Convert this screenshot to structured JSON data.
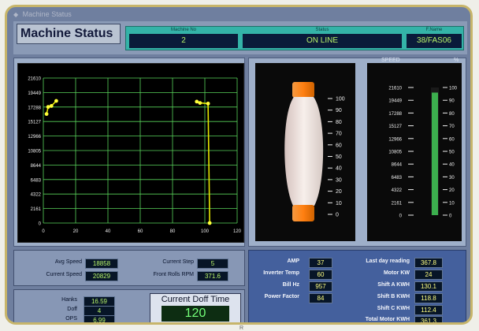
{
  "window": {
    "title": "Machine Status"
  },
  "header": {
    "title": "Machine Status",
    "machine_no_label": "Machine No",
    "machine_no": "2",
    "status_label": "Status",
    "status": "ON LINE",
    "fname_label": "F.Name",
    "fname": "38/FAS06"
  },
  "speed_chart": {
    "y_ticks": [
      "21610",
      "19449",
      "17288",
      "15127",
      "12966",
      "10805",
      "8644",
      "6483",
      "4322",
      "2161",
      "0"
    ],
    "x_ticks": [
      "0",
      "20",
      "40",
      "60",
      "80",
      "100",
      "120"
    ]
  },
  "chart_data": {
    "type": "scatter",
    "xlim": [
      0,
      120
    ],
    "ylim": [
      0,
      21610
    ],
    "series": [
      {
        "values": [
          [
            2,
            16250
          ],
          [
            3,
            17300
          ],
          [
            5,
            17450
          ],
          [
            8,
            18200
          ],
          [
            95,
            18100
          ],
          [
            97,
            17900
          ],
          [
            102,
            17800
          ],
          [
            103,
            0
          ]
        ]
      }
    ]
  },
  "bobbin_scale": [
    "100",
    "90",
    "80",
    "70",
    "60",
    "50",
    "40",
    "30",
    "20",
    "10",
    "0"
  ],
  "gauge": {
    "title": "SPEED",
    "unit": "%",
    "left_ticks": [
      "21610",
      "19449",
      "17288",
      "15127",
      "12966",
      "10805",
      "8644",
      "6483",
      "4322",
      "2161",
      "0"
    ],
    "right_ticks": [
      "100",
      "90",
      "80",
      "70",
      "60",
      "50",
      "40",
      "30",
      "20",
      "10",
      "0"
    ],
    "level_percent": 96
  },
  "speed_panel": {
    "avg_speed_label": "Avg Speed",
    "avg_speed": "18858",
    "current_speed_label": "Current Speed",
    "current_speed": "20829",
    "current_step_label": "Current Step",
    "current_step": "5",
    "front_rolls_label": "Front Rolls RPM",
    "front_rolls": "371.6"
  },
  "production_panel": {
    "hanks_label": "Hanks",
    "hanks": "16.59",
    "doff_label": "Doff",
    "doff": "4",
    "ops_label": "OPS",
    "ops": "6.99",
    "current_doff_time_label": "Current Doff Time",
    "current_doff_time": "120"
  },
  "electrical_panel": {
    "amp_label": "AMP",
    "amp": "37",
    "inverter_temp_label": "Inverter Temp",
    "inverter_temp": "60",
    "bill_hz_label": "Bill Hz",
    "bill_hz": "957",
    "power_factor_label": "Power Factor",
    "power_factor": "84",
    "last_day_reading_label": "Last day reading",
    "last_day_reading": "367.8",
    "motor_kw_label": "Motor KW",
    "motor_kw": "24",
    "shift_a_kwh_label": "Shift A KWH",
    "shift_a_kwh": "130.1",
    "shift_b_kwh_label": "Shift B KWH",
    "shift_b_kwh": "118.8",
    "shift_c_kwh_label": "Shift C KWH",
    "shift_c_kwh": "112.4",
    "total_motor_kwh_label": "Total Motor KWH",
    "total_motor_kwh": "361.3"
  },
  "footer": {
    "mark": "R"
  }
}
